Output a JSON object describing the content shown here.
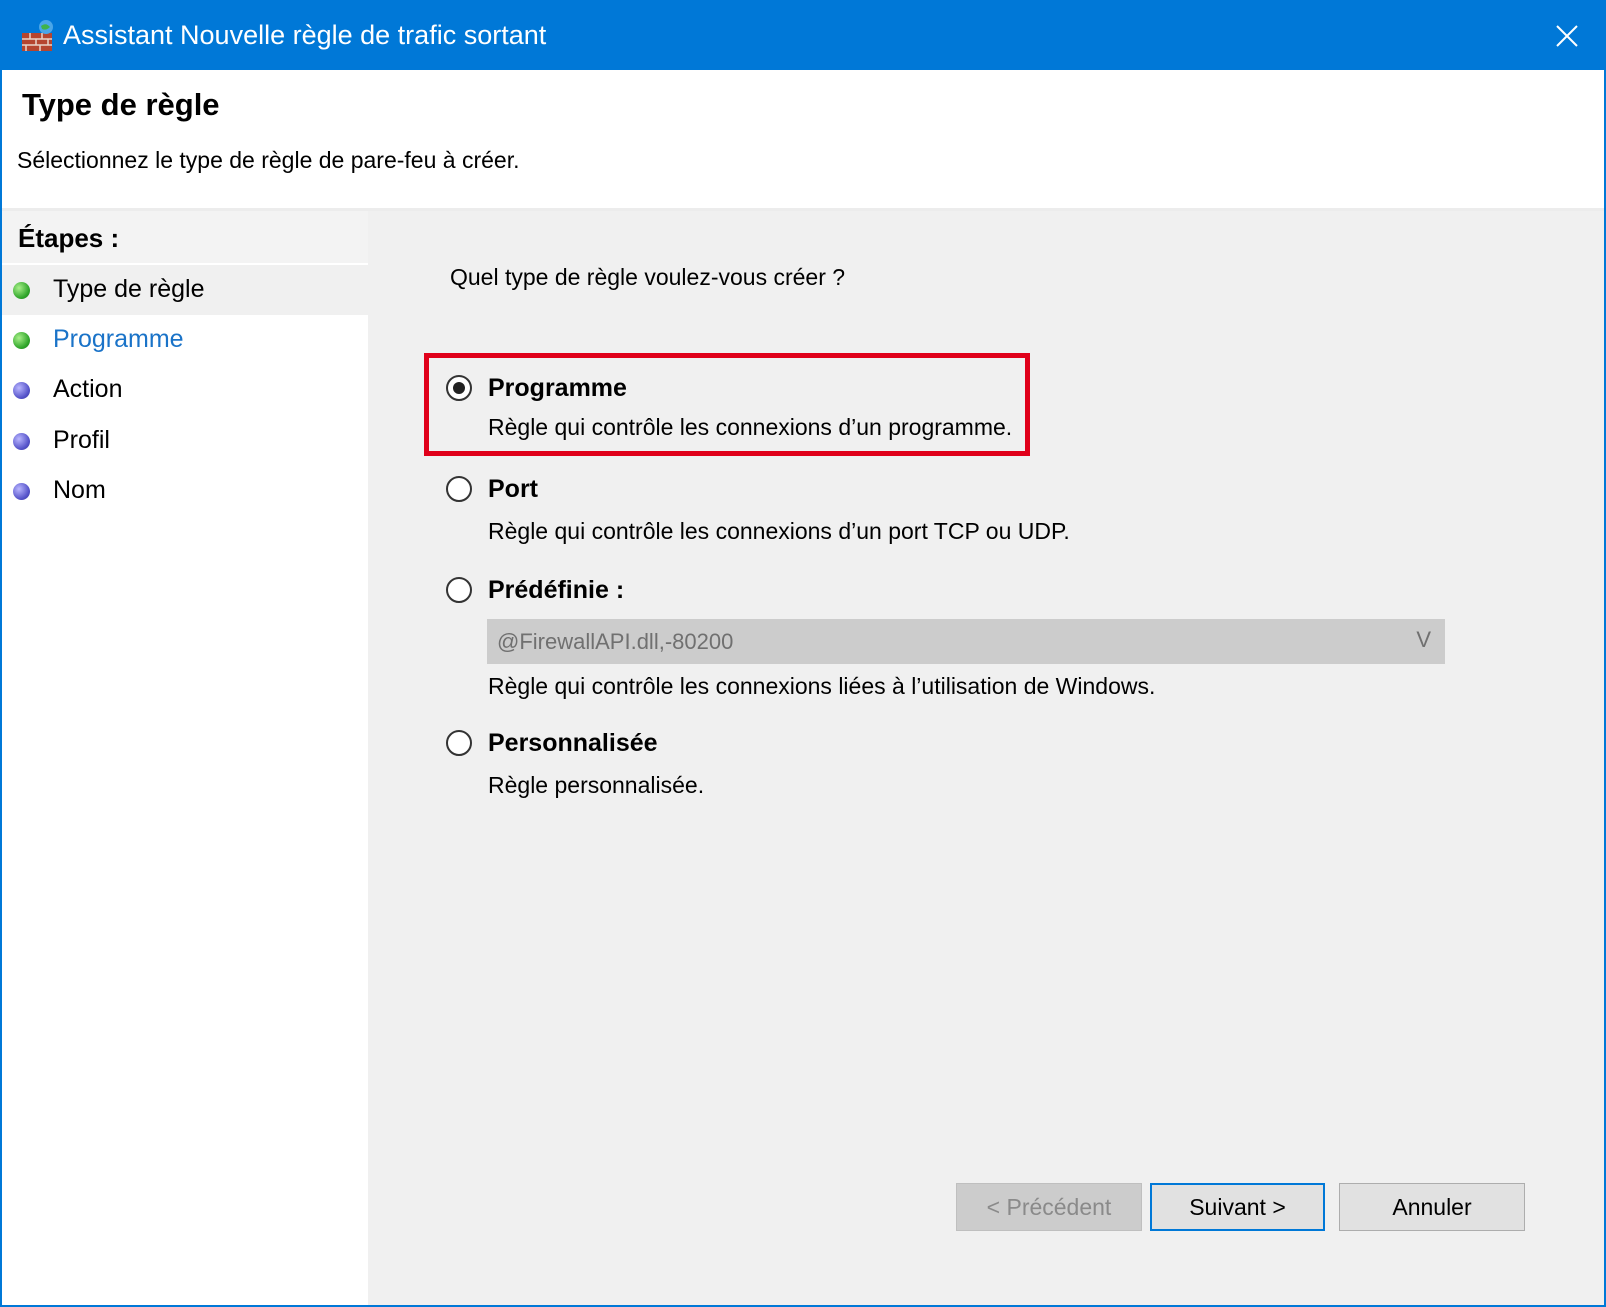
{
  "window": {
    "title": "Assistant Nouvelle règle de trafic sortant"
  },
  "header": {
    "title": "Type de règle",
    "subtitle": "Sélectionnez le type de règle de pare-feu à créer."
  },
  "sidebar": {
    "heading": "Étapes :",
    "steps": [
      {
        "label": "Type de règle",
        "status": "completed"
      },
      {
        "label": "Programme",
        "status": "completed"
      },
      {
        "label": "Action",
        "status": "pending"
      },
      {
        "label": "Profil",
        "status": "pending"
      },
      {
        "label": "Nom",
        "status": "pending"
      }
    ]
  },
  "main": {
    "question": "Quel type de règle voulez-vous créer ?",
    "options": [
      {
        "title": "Programme",
        "description": "Règle qui contrôle les connexions d’un programme.",
        "selected": true
      },
      {
        "title": "Port",
        "description": "Règle qui contrôle les connexions d’un port TCP ou UDP.",
        "selected": false
      },
      {
        "title": "Prédéfinie :",
        "description": "Règle qui contrôle les connexions liées à l’utilisation de Windows.",
        "selected": false
      },
      {
        "title": "Personnalisée",
        "description": "Règle personnalisée.",
        "selected": false
      }
    ],
    "predefined_dropdown": {
      "value": "@FirewallAPI.dll,-80200",
      "chevron": "V"
    }
  },
  "buttons": {
    "previous": "< Précédent",
    "next": "Suivant >",
    "cancel": "Annuler"
  },
  "colors": {
    "titlebar": "#0078d7",
    "highlight": "#e0001a",
    "active_step": "#1a73c8"
  },
  "icons": {
    "app": "firewall-icon",
    "close": "close-icon",
    "step_done": "green-dot-icon",
    "step_pending": "purple-dot-icon"
  }
}
